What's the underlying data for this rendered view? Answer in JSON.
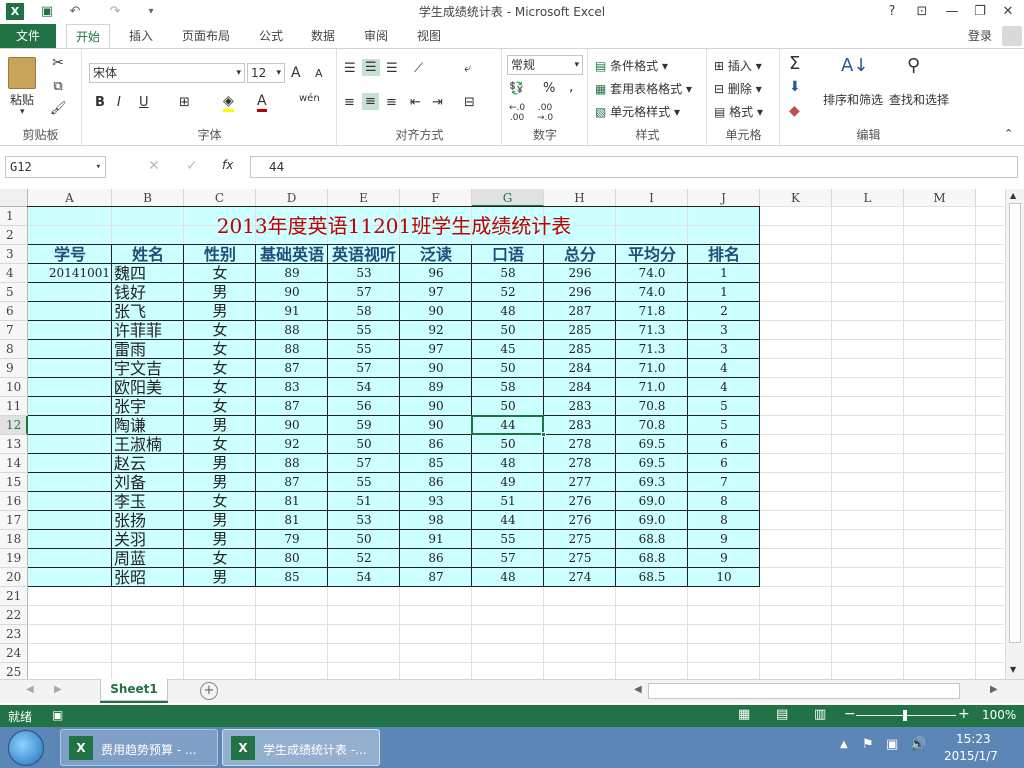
{
  "window": {
    "title": "学生成绩统计表 - Microsoft Excel",
    "help": "?",
    "signin": "登录"
  },
  "ribbon_tabs": [
    "文件",
    "开始",
    "插入",
    "页面布局",
    "公式",
    "数据",
    "审阅",
    "视图"
  ],
  "ribbon": {
    "clipboard": {
      "paste": "粘贴",
      "label": "剪贴板"
    },
    "font": {
      "name": "宋体",
      "size": "12",
      "bold": "B",
      "italic": "I",
      "underline": "U",
      "label": "字体",
      "grow": "A",
      "shrink": "A",
      "wen": "wén"
    },
    "align": {
      "label": "对齐方式"
    },
    "number": {
      "format": "常规",
      "percent": "%",
      "comma": ",",
      "label": "数字",
      "inc": "←.0\n.00",
      "dec": ".00\n→.0"
    },
    "styles": {
      "cond": "条件格式",
      "table": "套用表格格式",
      "cell": "单元格样式",
      "label": "样式"
    },
    "cells": {
      "insert": "插入",
      "delete": "删除",
      "format": "格式",
      "label": "单元格"
    },
    "editing": {
      "sort": "排序和筛选",
      "find": "查找和选择",
      "label": "编辑"
    }
  },
  "formula_bar": {
    "name_box": "G12",
    "fx": "fx",
    "value": "44"
  },
  "columns": [
    "A",
    "B",
    "C",
    "D",
    "E",
    "F",
    "G",
    "H",
    "I",
    "J",
    "K",
    "L",
    "M"
  ],
  "rows": [
    "1",
    "2",
    "3",
    "4",
    "5",
    "6",
    "7",
    "8",
    "9",
    "10",
    "11",
    "12",
    "13",
    "14",
    "15",
    "16",
    "17",
    "18",
    "19",
    "20",
    "21",
    "22",
    "23",
    "24",
    "25"
  ],
  "table": {
    "title": "2013年度英语11201班学生成绩统计表",
    "headers": [
      "学号",
      "姓名",
      "性别",
      "基础英语",
      "英语视听",
      "泛读",
      "口语",
      "总分",
      "平均分",
      "排名"
    ],
    "rows": [
      [
        "20141001",
        "魏四",
        "女",
        "89",
        "53",
        "96",
        "58",
        "296",
        "74.0",
        "1"
      ],
      [
        "",
        "钱好",
        "男",
        "90",
        "57",
        "97",
        "52",
        "296",
        "74.0",
        "1"
      ],
      [
        "",
        "张飞",
        "男",
        "91",
        "58",
        "90",
        "48",
        "287",
        "71.8",
        "2"
      ],
      [
        "",
        "许菲菲",
        "女",
        "88",
        "55",
        "92",
        "50",
        "285",
        "71.3",
        "3"
      ],
      [
        "",
        "雷雨",
        "女",
        "88",
        "55",
        "97",
        "45",
        "285",
        "71.3",
        "3"
      ],
      [
        "",
        "宇文吉",
        "女",
        "87",
        "57",
        "90",
        "50",
        "284",
        "71.0",
        "4"
      ],
      [
        "",
        "欧阳美",
        "女",
        "83",
        "54",
        "89",
        "58",
        "284",
        "71.0",
        "4"
      ],
      [
        "",
        "张宇",
        "女",
        "87",
        "56",
        "90",
        "50",
        "283",
        "70.8",
        "5"
      ],
      [
        "",
        "陶谦",
        "男",
        "90",
        "59",
        "90",
        "44",
        "283",
        "70.8",
        "5"
      ],
      [
        "",
        "王淑楠",
        "女",
        "92",
        "50",
        "86",
        "50",
        "278",
        "69.5",
        "6"
      ],
      [
        "",
        "赵云",
        "男",
        "88",
        "57",
        "85",
        "48",
        "278",
        "69.5",
        "6"
      ],
      [
        "",
        "刘备",
        "男",
        "87",
        "55",
        "86",
        "49",
        "277",
        "69.3",
        "7"
      ],
      [
        "",
        "李玉",
        "女",
        "81",
        "51",
        "93",
        "51",
        "276",
        "69.0",
        "8"
      ],
      [
        "",
        "张扬",
        "男",
        "81",
        "53",
        "98",
        "44",
        "276",
        "69.0",
        "8"
      ],
      [
        "",
        "关羽",
        "男",
        "79",
        "50",
        "91",
        "55",
        "275",
        "68.8",
        "9"
      ],
      [
        "",
        "周蓝",
        "女",
        "80",
        "52",
        "86",
        "57",
        "275",
        "68.8",
        "9"
      ],
      [
        "",
        "张昭",
        "男",
        "85",
        "54",
        "87",
        "48",
        "274",
        "68.5",
        "10"
      ]
    ]
  },
  "sheet_tab": "Sheet1",
  "status": {
    "ready": "就绪",
    "zoom": "100%"
  },
  "taskbar": {
    "items": [
      "费用趋势预算 - ...",
      "学生成绩统计表 -..."
    ],
    "time": "15:23",
    "date": "2015/1/7"
  },
  "colors": {
    "accent": "#217346",
    "fill": "#ccffff",
    "title_red": "#c00000",
    "header_blue": "#1f4e79"
  }
}
